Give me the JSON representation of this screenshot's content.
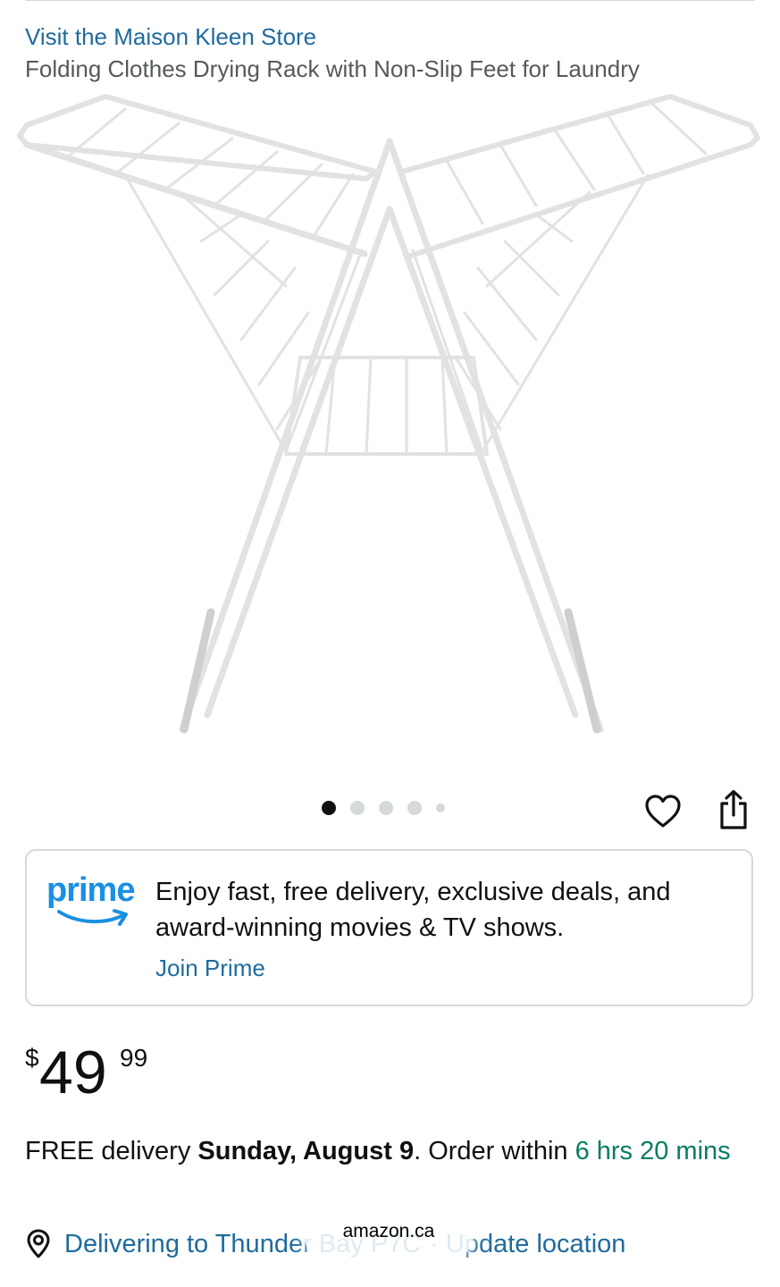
{
  "store": {
    "link_label": "Visit the Maison Kleen Store"
  },
  "product": {
    "title": "Folding Clothes Drying Rack with Non-Slip Feet for Laundry",
    "image_icon": "drying-rack-image"
  },
  "carousel": {
    "total_dots": 5,
    "active_index": 0
  },
  "actions": {
    "wishlist_icon": "heart-icon",
    "share_icon": "share-icon"
  },
  "prime": {
    "logo_text": "prime",
    "description_line1": "Enjoy fast, free delivery, exclusive deals, and",
    "description_line2": "award-winning movies & TV shows.",
    "cta_label": "Join Prime",
    "brand_color": "#1a8fe3"
  },
  "price": {
    "symbol": "$",
    "whole": "49",
    "fraction": "99"
  },
  "delivery": {
    "prefix": "FREE delivery ",
    "date": "Sunday, August 9",
    "middle": ". Order within ",
    "countdown": "6 hrs 20 mins",
    "countdown_color": "#067d62"
  },
  "location": {
    "icon": "location-pin-icon",
    "text": "Delivering to Thunder Bay P7C",
    "separator": "·",
    "update_label": "Update location"
  },
  "browser": {
    "url": "amazon.ca"
  },
  "colors": {
    "link": "#1f6b9e",
    "text": "#0f1111",
    "secondary_text": "#565959",
    "border": "#d5d9d9"
  }
}
